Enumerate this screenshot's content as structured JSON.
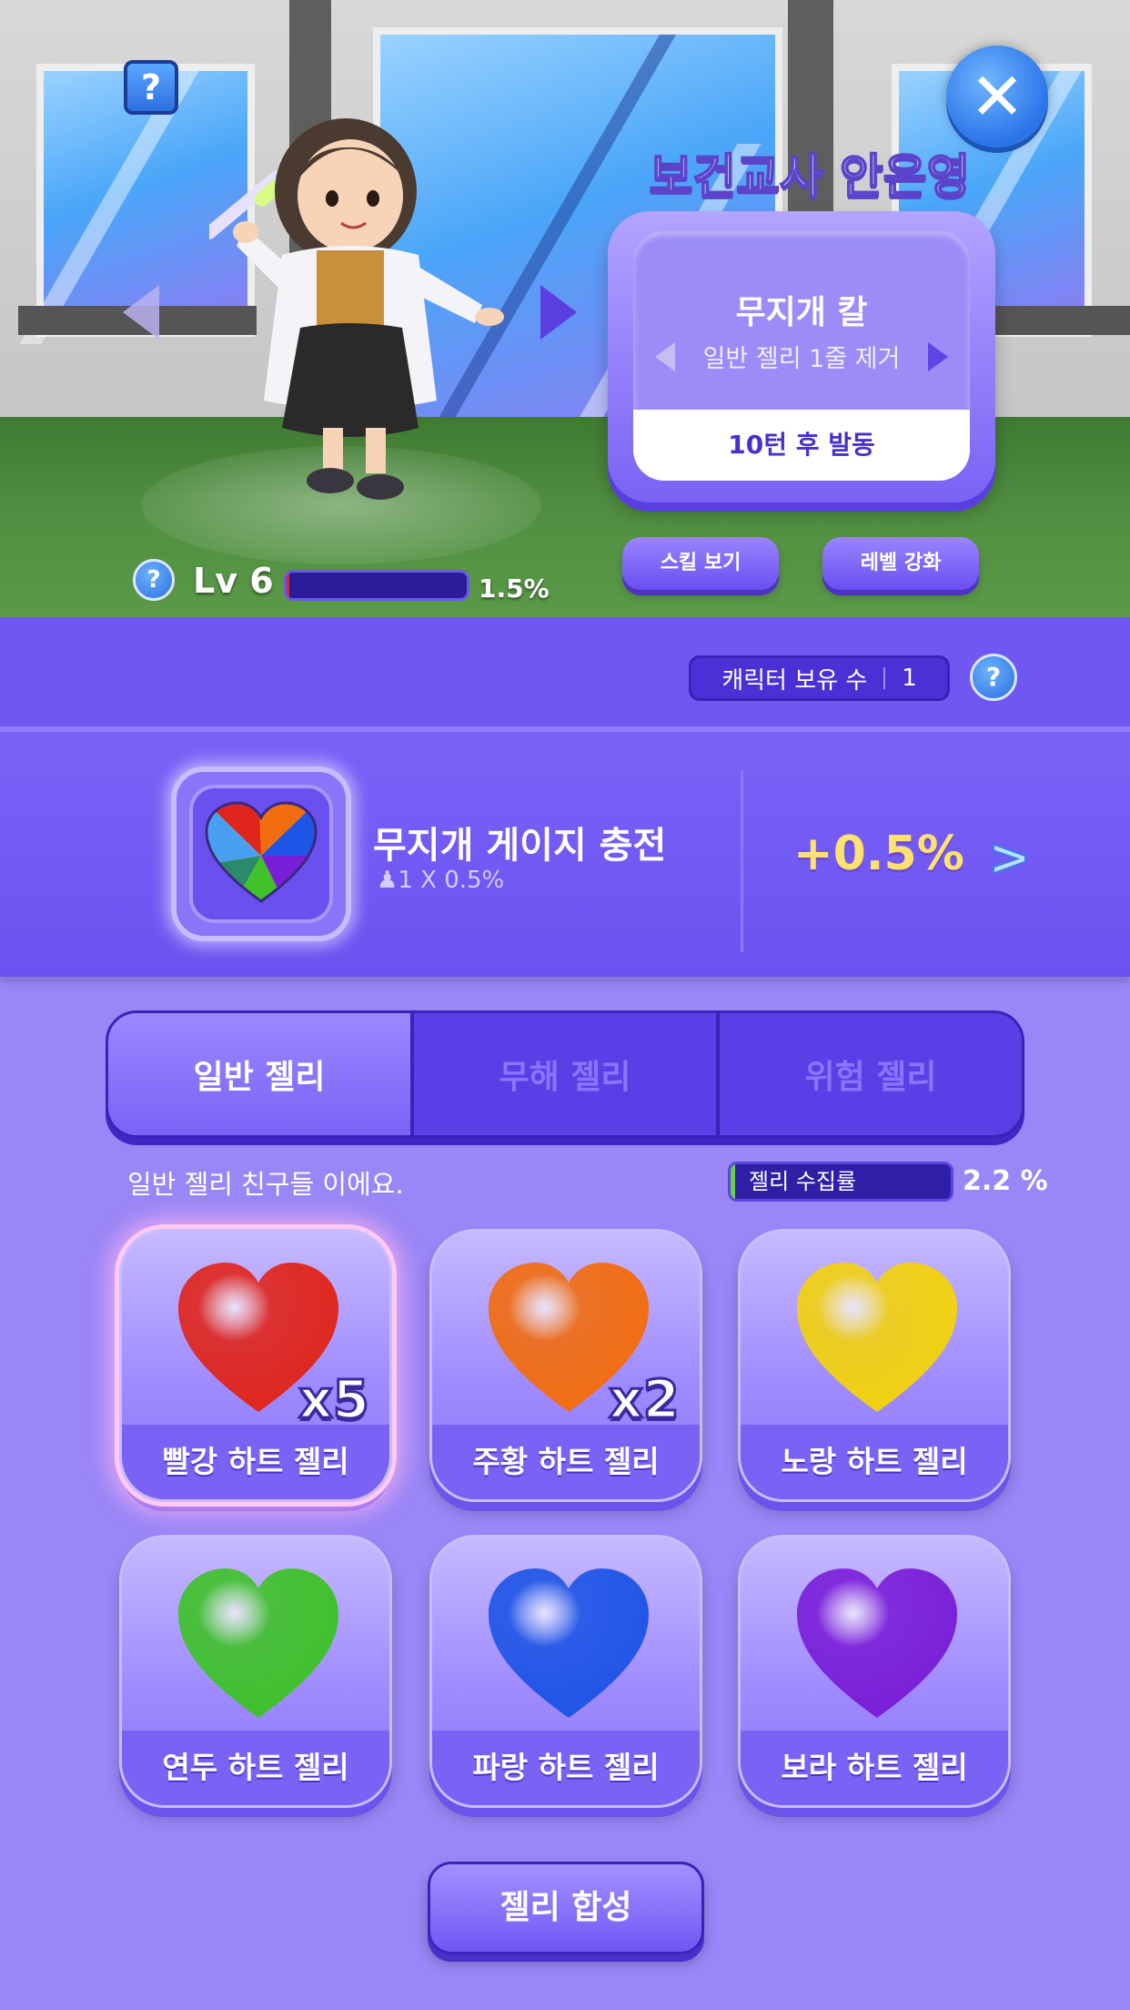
{
  "character": {
    "name": "보건교사 안은영",
    "level_label": "Lv 6",
    "level_progress": 0.015,
    "level_percent_label": "1.5%"
  },
  "skill": {
    "name": "무지개 칼",
    "description": "일반 젤리 1줄 제거",
    "trigger_text": "10턴 후 발동"
  },
  "buttons": {
    "view_skill": "스킬 보기",
    "level_up": "레벨 강화",
    "synthesize": "젤리 합성"
  },
  "owned": {
    "label": "캐릭터 보유 수",
    "count": "1"
  },
  "bonus": {
    "title": "무지개 게이지 충전",
    "formula": "1 X 0.5%",
    "value": "+0.5%"
  },
  "tabs": [
    {
      "label": "일반 젤리",
      "active": true
    },
    {
      "label": "무해 젤리",
      "active": false
    },
    {
      "label": "위험 젤리",
      "active": false
    }
  ],
  "collection": {
    "description": "일반 젤리 친구들 이에요.",
    "label": "젤리 수집률",
    "progress": 0.022,
    "percent_label": "2.2 %"
  },
  "jellies": [
    {
      "name": "빨강 하트 젤리",
      "count": "x5",
      "color": "#e0261c"
    },
    {
      "name": "주황 하트 젤리",
      "count": "x2",
      "color": "#f26d10"
    },
    {
      "name": "노랑 하트 젤리",
      "count": "",
      "color": "#f2d20e"
    },
    {
      "name": "연두 하트 젤리",
      "count": "",
      "color": "#3fc22a"
    },
    {
      "name": "파랑 하트 젤리",
      "count": "",
      "color": "#1f55e6"
    },
    {
      "name": "보라 하트 젤리",
      "count": "",
      "color": "#7a1fd8"
    }
  ],
  "icons": {
    "help_square": "question-portrait-icon",
    "close": "close-icon",
    "rainbow_heart": "rainbow-heart-icon",
    "person": "person-icon",
    "next": "chevron-right-icon"
  }
}
